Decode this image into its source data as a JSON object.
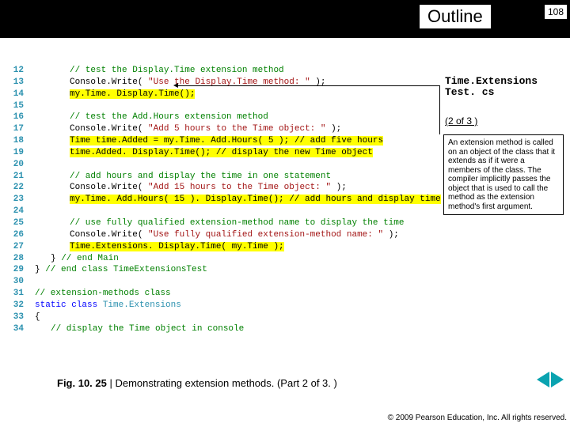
{
  "header": {
    "title": "Outline",
    "page_number": "108"
  },
  "code": {
    "lines": [
      {
        "n": "12",
        "ind": 1,
        "segs": [
          {
            "c": "cm",
            "t": "// test the Display.Time extension method"
          }
        ]
      },
      {
        "n": "13",
        "ind": 1,
        "segs": [
          {
            "t": "Console.Write( "
          },
          {
            "c": "str",
            "t": "\"Use the Display.Time method: \""
          },
          {
            "t": " );"
          }
        ]
      },
      {
        "n": "14",
        "ind": 1,
        "segs": [
          {
            "c": "hl",
            "t": "my.Time. Display.Time();"
          }
        ]
      },
      {
        "n": "15",
        "ind": 1,
        "segs": []
      },
      {
        "n": "16",
        "ind": 1,
        "segs": [
          {
            "c": "cm",
            "t": "// test the Add.Hours extension method"
          }
        ]
      },
      {
        "n": "17",
        "ind": 1,
        "segs": [
          {
            "t": "Console.Write( "
          },
          {
            "c": "str",
            "t": "\"Add 5 hours to the Time object: \""
          },
          {
            "t": " );"
          }
        ]
      },
      {
        "n": "18",
        "ind": 1,
        "segs": [
          {
            "c": "hl",
            "t": "Time time.Added = my.Time. Add.Hours( 5 ); // add five hours"
          }
        ]
      },
      {
        "n": "19",
        "ind": 1,
        "segs": [
          {
            "c": "hl",
            "t": "time.Added. Display.Time(); // display the new Time object"
          }
        ]
      },
      {
        "n": "20",
        "ind": 1,
        "segs": []
      },
      {
        "n": "21",
        "ind": 1,
        "segs": [
          {
            "c": "cm",
            "t": "// add hours and display the time in one statement"
          }
        ]
      },
      {
        "n": "22",
        "ind": 1,
        "segs": [
          {
            "t": "Console.Write( "
          },
          {
            "c": "str",
            "t": "\"Add 15 hours to the Time object: \""
          },
          {
            "t": " );"
          }
        ]
      },
      {
        "n": "23",
        "ind": 1,
        "segs": [
          {
            "c": "hl",
            "t": "my.Time. Add.Hours( 15 ). Display.Time(); // add hours and display time"
          }
        ]
      },
      {
        "n": "24",
        "ind": 1,
        "segs": []
      },
      {
        "n": "25",
        "ind": 1,
        "segs": [
          {
            "c": "cm",
            "t": "// use fully qualified extension-method name to display the time"
          }
        ]
      },
      {
        "n": "26",
        "ind": 1,
        "segs": [
          {
            "t": "Console.Write( "
          },
          {
            "c": "str",
            "t": "\"Use fully qualified extension-method name: \""
          },
          {
            "t": " );"
          }
        ]
      },
      {
        "n": "27",
        "ind": 1,
        "segs": [
          {
            "c": "hl",
            "t": "Time.Extensions. Display.Time( my.Time );"
          }
        ]
      },
      {
        "n": "28",
        "ind": 0,
        "segs": [
          {
            "t": "} "
          },
          {
            "c": "cm",
            "t": "// end Main"
          }
        ]
      },
      {
        "n": "29",
        "ind": -1,
        "segs": [
          {
            "t": "} "
          },
          {
            "c": "cm",
            "t": "// end class TimeExtensionsTest"
          }
        ]
      },
      {
        "n": "30",
        "ind": -1,
        "segs": []
      },
      {
        "n": "31",
        "ind": -1,
        "segs": [
          {
            "c": "cm",
            "t": "// extension-methods class"
          }
        ]
      },
      {
        "n": "32",
        "ind": -1,
        "segs": [
          {
            "c": "kw",
            "t": "static class"
          },
          {
            "t": " "
          },
          {
            "c": "typ",
            "t": "Time.Extensions"
          }
        ]
      },
      {
        "n": "33",
        "ind": -1,
        "segs": [
          {
            "t": "{"
          }
        ]
      },
      {
        "n": "34",
        "ind": 0,
        "segs": [
          {
            "c": "cm",
            "t": "// display the Time object in console"
          }
        ]
      }
    ]
  },
  "side": {
    "filename_line1": "Time.Extensions",
    "filename_line2": "Test. cs",
    "part": "(2 of 3 )",
    "annotation": "An extension method is called on an object of the class that it extends as if it were a members of the class. The compiler implicitly passes the object that is used to call the method as the extension method's first argument."
  },
  "caption": {
    "fig": "Fig. 10. 25",
    "sep": " | ",
    "text": "Demonstrating extension methods. (Part 2 of 3. )"
  },
  "footer": {
    "copyright": "© 2009 Pearson Education, Inc.  All rights reserved."
  }
}
